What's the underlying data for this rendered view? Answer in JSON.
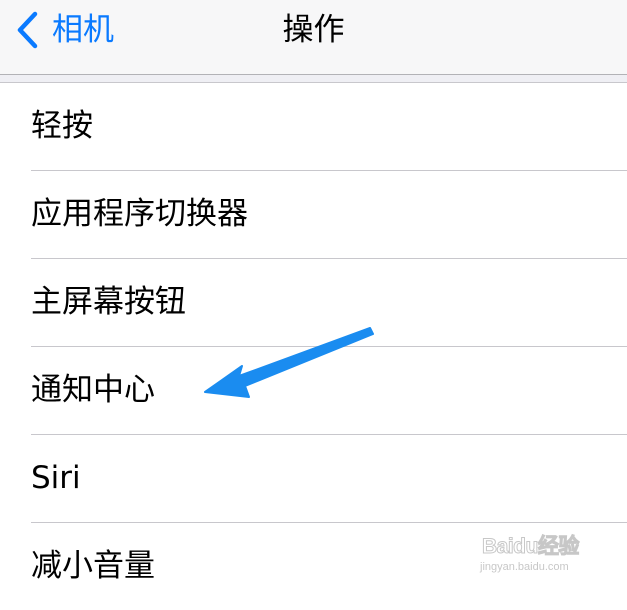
{
  "navbar": {
    "back_label": "相机",
    "title": "操作"
  },
  "list": {
    "items": [
      {
        "label": "轻按"
      },
      {
        "label": "应用程序切换器"
      },
      {
        "label": "主屏幕按钮"
      },
      {
        "label": "通知中心"
      },
      {
        "label": "Siri"
      },
      {
        "label": "减小音量"
      }
    ]
  },
  "annotation": {
    "arrow_icon": "arrow-icon",
    "arrow_color": "#1a8cf0"
  },
  "watermark": {
    "logo_text": "Baidu经验",
    "url": "jingyan.baidu.com"
  },
  "colors": {
    "accent": "#0a7aff",
    "navbar_bg": "#f7f7f8",
    "separator": "#c8c7cc"
  }
}
